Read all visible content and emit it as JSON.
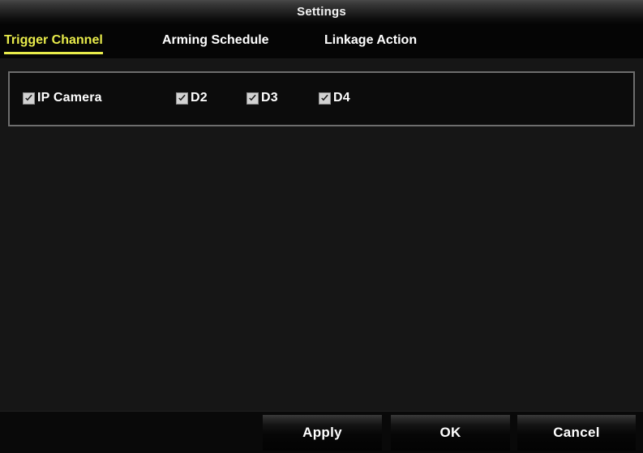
{
  "window": {
    "title": "Settings"
  },
  "tabs": [
    {
      "label": "Trigger Channel",
      "active": true
    },
    {
      "label": "Arming Schedule",
      "active": false
    },
    {
      "label": "Linkage Action",
      "active": false
    }
  ],
  "channel_panel": {
    "items": [
      {
        "label": "IP Camera",
        "checked": true
      },
      {
        "label": "D2",
        "checked": true
      },
      {
        "label": "D3",
        "checked": true
      },
      {
        "label": "D4",
        "checked": true
      }
    ]
  },
  "footer": {
    "apply_label": "Apply",
    "ok_label": "OK",
    "cancel_label": "Cancel"
  },
  "colors": {
    "accent": "#e9ec4b",
    "text": "#ffffff",
    "window_bg": "#161616",
    "panel_bg": "#0c0c0c",
    "panel_border": "#6e6e6e"
  }
}
